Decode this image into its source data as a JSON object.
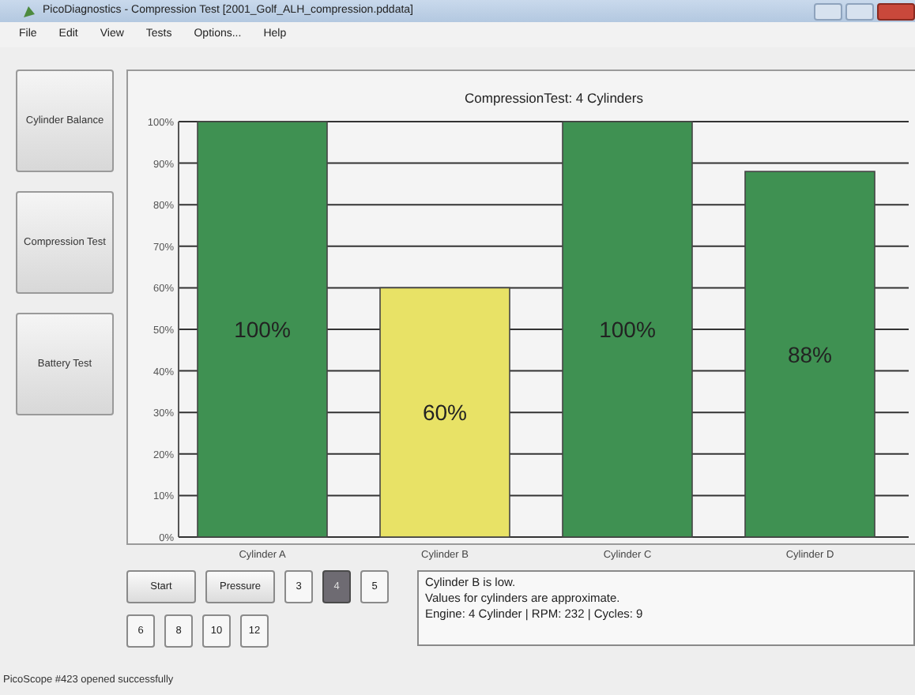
{
  "window": {
    "title": "PicoDiagnostics - Compression Test [2001_Golf_ALH_compression.pddata]"
  },
  "menu": [
    "File",
    "Edit",
    "View",
    "Tests",
    "Options...",
    "Help"
  ],
  "sidebar": [
    {
      "label": "Cylinder Balance"
    },
    {
      "label": "Compression Test"
    },
    {
      "label": "Battery Test"
    }
  ],
  "chart": {
    "chart_data": {
      "type": "bar",
      "title": "CompressionTest: 4 Cylinders",
      "categories": [
        "Cylinder A",
        "Cylinder B",
        "Cylinder C",
        "Cylinder D"
      ],
      "values": [
        100,
        60,
        100,
        88
      ],
      "grid": true,
      "ylim": [
        0,
        100
      ],
      "yticks": [
        {
          "value": 0,
          "label": "0%"
        },
        {
          "value": 10,
          "label": "10%"
        },
        {
          "value": 20,
          "label": "20%"
        },
        {
          "value": 30,
          "label": "30%"
        },
        {
          "value": 40,
          "label": "40%"
        },
        {
          "value": 50,
          "label": "50%"
        },
        {
          "value": 60,
          "label": "60%"
        },
        {
          "value": 70,
          "label": "70%"
        },
        {
          "value": 80,
          "label": "80%"
        },
        {
          "value": 90,
          "label": "90%"
        },
        {
          "value": 100,
          "label": "100%"
        }
      ],
      "value_labels": [
        "100%",
        "60%",
        "100%",
        "88%"
      ]
    },
    "bars": [
      {
        "color": "#3f9152"
      },
      {
        "color": "#e8e266"
      },
      {
        "color": "#3f9152"
      },
      {
        "color": "#3f9152"
      }
    ]
  },
  "controls": {
    "start": "Start",
    "pressure": "Pressure",
    "cylinder_counts": [
      {
        "label": "3",
        "selected": false
      },
      {
        "label": "4",
        "selected": true
      },
      {
        "label": "5",
        "selected": false
      },
      {
        "label": "6",
        "selected": false
      },
      {
        "label": "8",
        "selected": false
      },
      {
        "label": "10",
        "selected": false
      },
      {
        "label": "12",
        "selected": false
      }
    ]
  },
  "messages": [
    "Cylinder B is low.",
    "Values for cylinders are approximate.",
    "Engine: 4 Cylinder | RPM: 232 | Cycles: 9"
  ],
  "status_bar": "PicoScope #423 opened successfully"
}
